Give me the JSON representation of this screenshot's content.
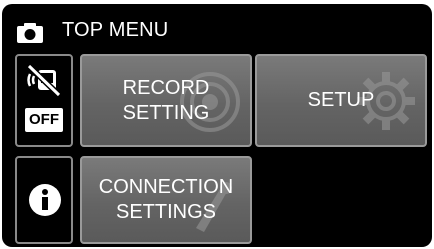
{
  "header": {
    "title": "TOP MENU",
    "mode_icon": "camera-icon"
  },
  "sidebar": {
    "silent_mode_icon": "silent-mode-icon",
    "silent_mode_state": "OFF",
    "info_icon": "info-icon"
  },
  "menu": {
    "record_line1": "RECORD",
    "record_line2": "SETTING",
    "setup": "SETUP",
    "connection_line1": "CONNECTION",
    "connection_line2": "SETTINGS"
  },
  "colors": {
    "background": "#000000",
    "tile": "#6e6e6e",
    "tile_border": "#9a9a9a",
    "text": "#ffffff"
  }
}
